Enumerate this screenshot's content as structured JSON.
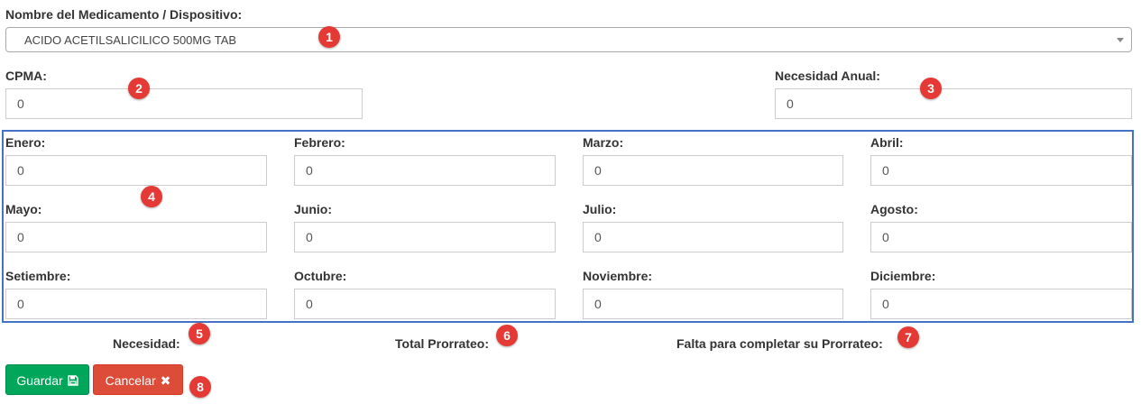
{
  "medicamento": {
    "label": "Nombre del Medicamento / Dispositivo:",
    "selected": "ACIDO ACETILSALICILICO 500MG TAB"
  },
  "cpma": {
    "label": "CPMA:",
    "value": "0"
  },
  "necesidad_anual": {
    "label": "Necesidad Anual:",
    "value": "0"
  },
  "months": [
    {
      "label": "Enero:",
      "value": "0"
    },
    {
      "label": "Febrero:",
      "value": "0"
    },
    {
      "label": "Marzo:",
      "value": "0"
    },
    {
      "label": "Abril:",
      "value": "0"
    },
    {
      "label": "Mayo:",
      "value": "0"
    },
    {
      "label": "Junio:",
      "value": "0"
    },
    {
      "label": "Julio:",
      "value": "0"
    },
    {
      "label": "Agosto:",
      "value": "0"
    },
    {
      "label": "Setiembre:",
      "value": "0"
    },
    {
      "label": "Octubre:",
      "value": "0"
    },
    {
      "label": "Noviembre:",
      "value": "0"
    },
    {
      "label": "Diciembre:",
      "value": "0"
    }
  ],
  "summary": {
    "necesidad": "Necesidad:",
    "total_prorrateo": "Total Prorrateo:",
    "falta": "Falta para completar su Prorrateo:"
  },
  "buttons": {
    "guardar": "Guardar",
    "guardar_icon": "floppy-disk-icon",
    "cancelar": "Cancelar",
    "cancelar_icon": "close-icon"
  },
  "badges": [
    "1",
    "2",
    "3",
    "4",
    "5",
    "6",
    "7",
    "8"
  ],
  "colors": {
    "badge": "#e53935",
    "highlight_border": "#4472c4",
    "save": "#00a65a",
    "cancel": "#dd4b39"
  }
}
